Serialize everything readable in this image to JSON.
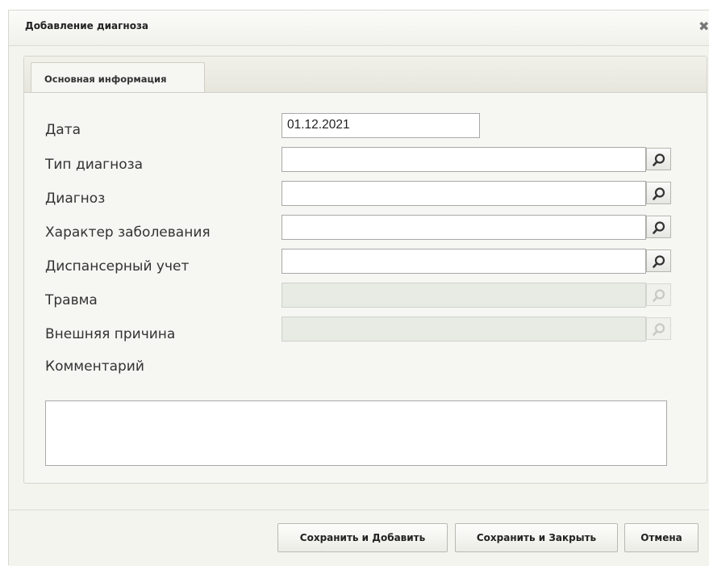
{
  "dialog": {
    "title": "Добавление диагноза"
  },
  "tabs": [
    {
      "label": "Основная информация",
      "active": true
    }
  ],
  "form": {
    "date_label": "Дата",
    "date_value": "01.12.2021",
    "diagnosis_type_label": "Тип диагноза",
    "diagnosis_type_value": "",
    "diagnosis_label": "Диагноз",
    "diagnosis_value": "",
    "disease_nature_label": "Характер заболевания",
    "disease_nature_value": "",
    "dispensary_label": "Диспансерный учет",
    "dispensary_value": "",
    "injury_label": "Травма",
    "injury_value": "",
    "external_cause_label": "Внешняя причина",
    "external_cause_value": "",
    "comment_label": "Комментарий",
    "comment_value": ""
  },
  "buttons": {
    "save_add": "Сохранить и Добавить",
    "save_close": "Сохранить и Закрыть",
    "cancel": "Отмена"
  },
  "icons": {
    "close": "close-icon",
    "lookup": "search-icon"
  },
  "colors": {
    "dialog_bg": "#f4f4ef",
    "disabled_field": "#e8eae4"
  }
}
